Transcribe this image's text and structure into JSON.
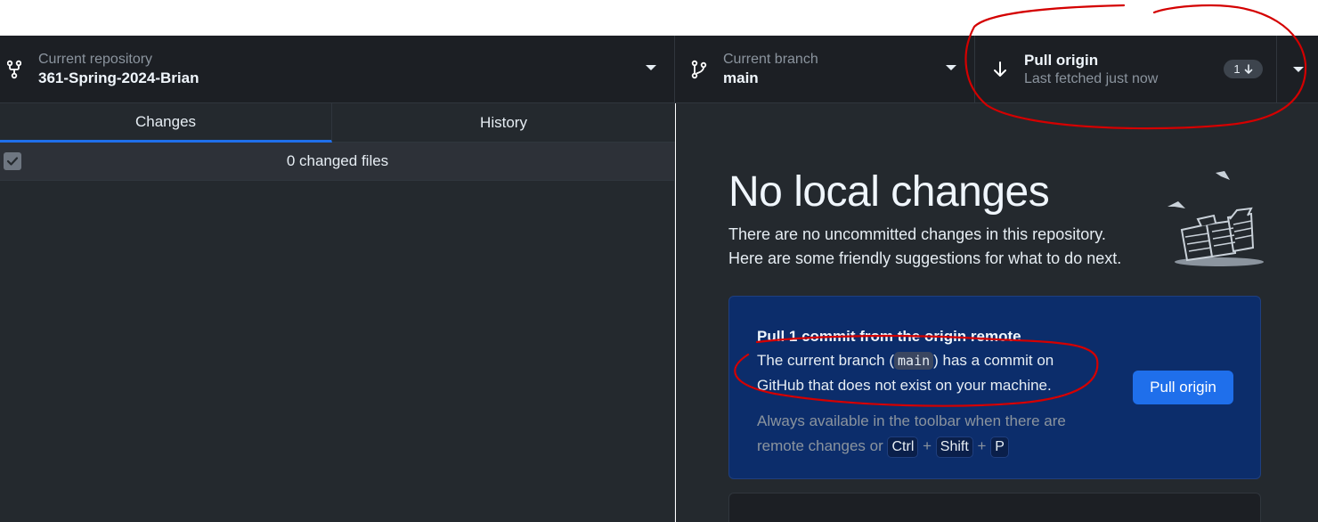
{
  "toolbar": {
    "repo_label": "Current repository",
    "repo_name": "361-Spring-2024-Brian",
    "branch_label": "Current branch",
    "branch_name": "main",
    "pull_title": "Pull origin",
    "pull_subtitle": "Last fetched just now",
    "pull_count": "1"
  },
  "tabs": {
    "changes": "Changes",
    "history": "History"
  },
  "files": {
    "summary": "0 changed files"
  },
  "main": {
    "title": "No local changes",
    "desc_line1": "There are no uncommitted changes in this repository.",
    "desc_line2": "Here are some friendly suggestions for what to do next."
  },
  "card": {
    "title": "Pull 1 commit from the origin remote",
    "body_pre": "The current branch (",
    "branch_code": "main",
    "body_post": ") has a commit on GitHub that does not exist on your machine.",
    "hint_text": "Always available in the toolbar when there are remote changes or",
    "key_ctrl": "Ctrl",
    "key_shift": "Shift",
    "key_p": "P",
    "button": "Pull origin"
  },
  "colors": {
    "accent": "#1f6feb",
    "card_bg": "#0c2d6b",
    "annotation": "#d40000"
  }
}
